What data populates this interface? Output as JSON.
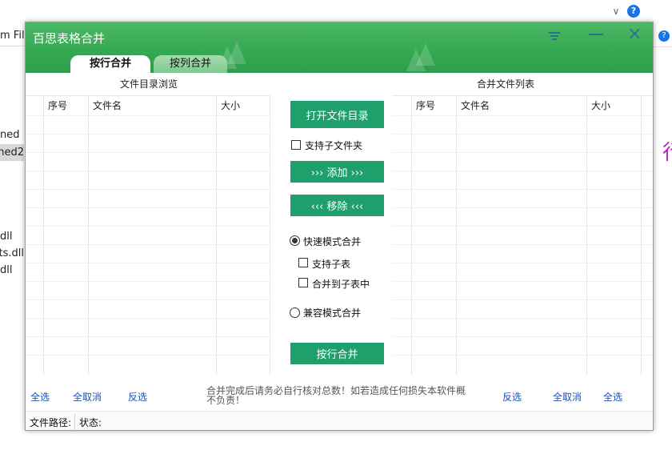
{
  "background": {
    "address_text": "m File",
    "files": [
      "ned",
      "ned2",
      "dll",
      "ats.dll",
      "dll"
    ],
    "selected_file_index": 1,
    "help_glyph": "?",
    "chevron_glyph": "∨",
    "right_badge": "?",
    "right_glyph": "行"
  },
  "app": {
    "title": "百思表格合并",
    "tabs": [
      {
        "label": "按行合并",
        "active": true
      },
      {
        "label": "按列合并",
        "active": false
      }
    ],
    "close_glyph": "×",
    "left_panel": {
      "caption": "文件目录浏览",
      "columns": [
        "序号",
        "文件名",
        "大小"
      ]
    },
    "right_panel": {
      "caption": "合并文件列表",
      "columns": [
        "序号",
        "文件名",
        "大小"
      ]
    },
    "controls": {
      "open_dir": "打开文件目录",
      "include_subfolders": "支持子文件夹",
      "add": "››› 添加 ›››",
      "remove": "‹‹‹ 移除 ‹‹‹",
      "fast_mode": "快速模式合并",
      "fast_mode_selected": true,
      "support_sheets": "支持子表",
      "merge_into_sheet": "合并到子表中",
      "compat_mode": "兼容模式合并",
      "merge_button": "按行合并"
    },
    "left_links": [
      "全选",
      "全取消",
      "反选"
    ],
    "right_links": [
      "反选",
      "全取消",
      "全选"
    ],
    "notice": "合并完成后请务必自行核对总数！如若造成任何损失本软件概不负责！",
    "status": {
      "path_label": "文件路径:",
      "state_label": "状态:"
    }
  },
  "colors": {
    "title_green": "#34a852",
    "button_green": "#1f9f6b",
    "link_blue": "#1a4fb0"
  }
}
